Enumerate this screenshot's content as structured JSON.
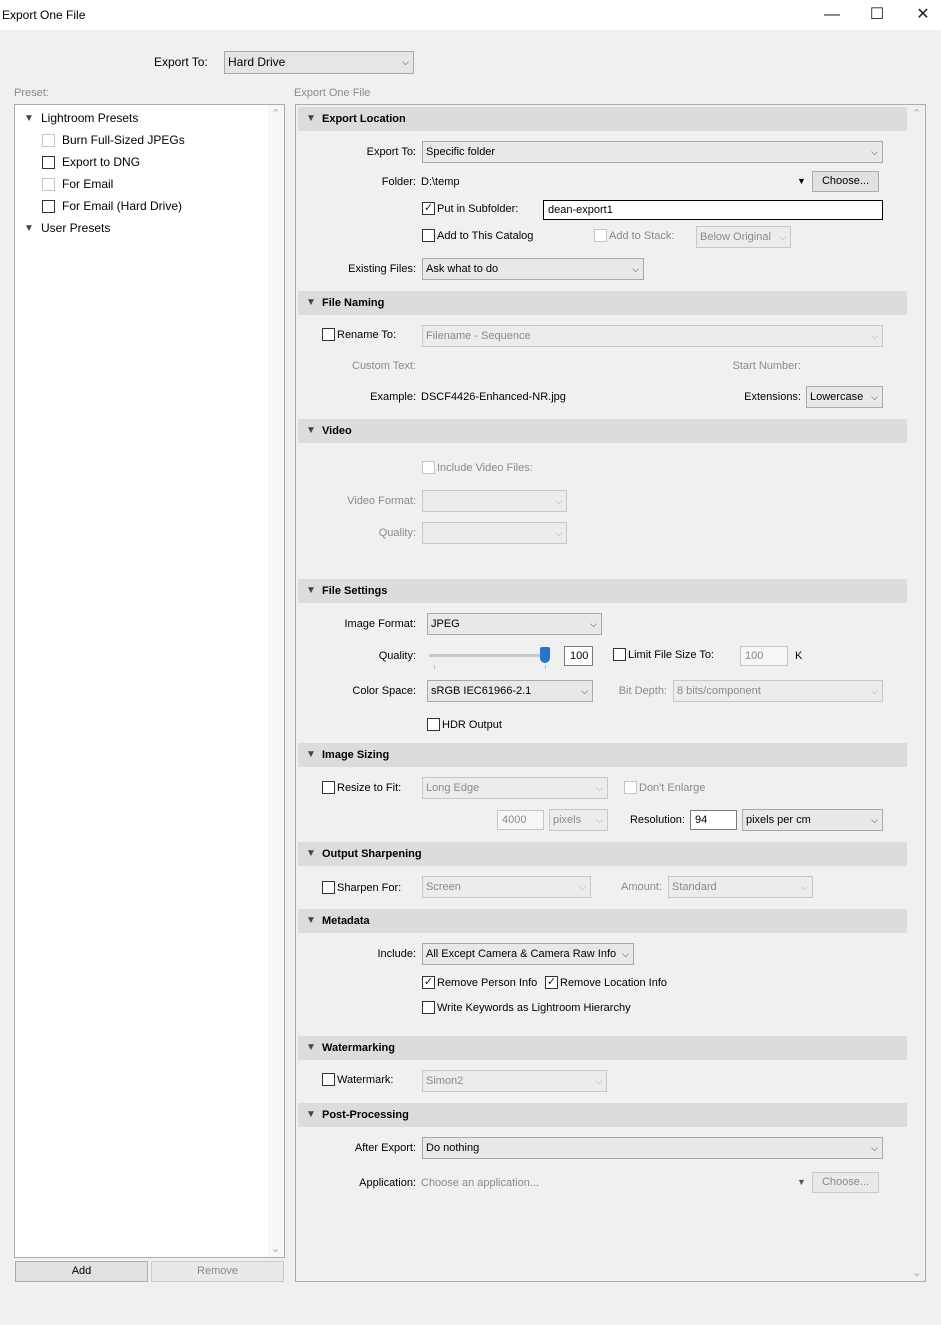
{
  "window": {
    "title": "Export One File",
    "minimize": "—",
    "maximize": "☐",
    "close": "✕"
  },
  "top": {
    "export_to_label": "Export To:",
    "export_to_value": "Hard Drive"
  },
  "presets": {
    "header": "Preset:",
    "groups": [
      {
        "name": "Lightroom Presets",
        "items": [
          "Burn Full-Sized JPEGs",
          "Export to DNG",
          "For Email",
          "For Email (Hard Drive)"
        ]
      },
      {
        "name": "User Presets",
        "items": []
      }
    ],
    "add_button": "Add",
    "remove_button": "Remove"
  },
  "panel_title": "Export One File",
  "export_location": {
    "title": "Export Location",
    "export_to_label": "Export To:",
    "export_to_value": "Specific folder",
    "folder_label": "Folder:",
    "folder_value": "D:\\temp",
    "choose_button": "Choose...",
    "put_in_subfolder_label": "Put in Subfolder:",
    "put_in_subfolder_checked": true,
    "subfolder_value": "dean-export1",
    "add_to_catalog_label": "Add to This Catalog",
    "add_to_stack_label": "Add to Stack:",
    "below_original": "Below Original",
    "existing_files_label": "Existing Files:",
    "existing_files_value": "Ask what to do"
  },
  "file_naming": {
    "title": "File Naming",
    "rename_to_label": "Rename To:",
    "rename_to_value": "Filename - Sequence",
    "custom_text_label": "Custom Text:",
    "start_number_label": "Start Number:",
    "example_label": "Example:",
    "example_value": "DSCF4426-Enhanced-NR.jpg",
    "extensions_label": "Extensions:",
    "extensions_value": "Lowercase"
  },
  "video": {
    "title": "Video",
    "include_video_label": "Include Video Files:",
    "video_format_label": "Video Format:",
    "quality_label": "Quality:"
  },
  "file_settings": {
    "title": "File Settings",
    "image_format_label": "Image Format:",
    "image_format_value": "JPEG",
    "quality_label": "Quality:",
    "quality_value": "100",
    "quality_fraction": 1.0,
    "limit_file_size_label": "Limit File Size To:",
    "limit_value": "100",
    "limit_unit": "K",
    "color_space_label": "Color Space:",
    "color_space_value": "sRGB IEC61966-2.1",
    "bit_depth_label": "Bit Depth:",
    "bit_depth_value": "8 bits/component",
    "hdr_output_label": "HDR Output"
  },
  "image_sizing": {
    "title": "Image Sizing",
    "resize_to_fit_label": "Resize to Fit:",
    "resize_mode": "Long Edge",
    "dont_enlarge_label": "Don't Enlarge",
    "size_value": "4000",
    "size_unit": "pixels",
    "resolution_label": "Resolution:",
    "resolution_value": "94",
    "resolution_unit": "pixels per cm"
  },
  "output_sharpening": {
    "title": "Output Sharpening",
    "sharpen_for_label": "Sharpen For:",
    "sharpen_for_value": "Screen",
    "amount_label": "Amount:",
    "amount_value": "Standard"
  },
  "metadata": {
    "title": "Metadata",
    "include_label": "Include:",
    "include_value": "All Except Camera & Camera Raw Info",
    "remove_person_label": "Remove Person Info",
    "remove_location_label": "Remove Location Info",
    "write_keywords_label": "Write Keywords as Lightroom Hierarchy"
  },
  "watermarking": {
    "title": "Watermarking",
    "watermark_label": "Watermark:",
    "watermark_value": "Simon2"
  },
  "post_processing": {
    "title": "Post-Processing",
    "after_export_label": "After Export:",
    "after_export_value": "Do nothing",
    "application_label": "Application:",
    "application_placeholder": "Choose an application...",
    "choose_button": "Choose..."
  },
  "glyphs": {
    "check": "✓",
    "chev": "⌵",
    "tri_down": "▼",
    "scroll_up": "⌃",
    "scroll_down": "⌄"
  }
}
